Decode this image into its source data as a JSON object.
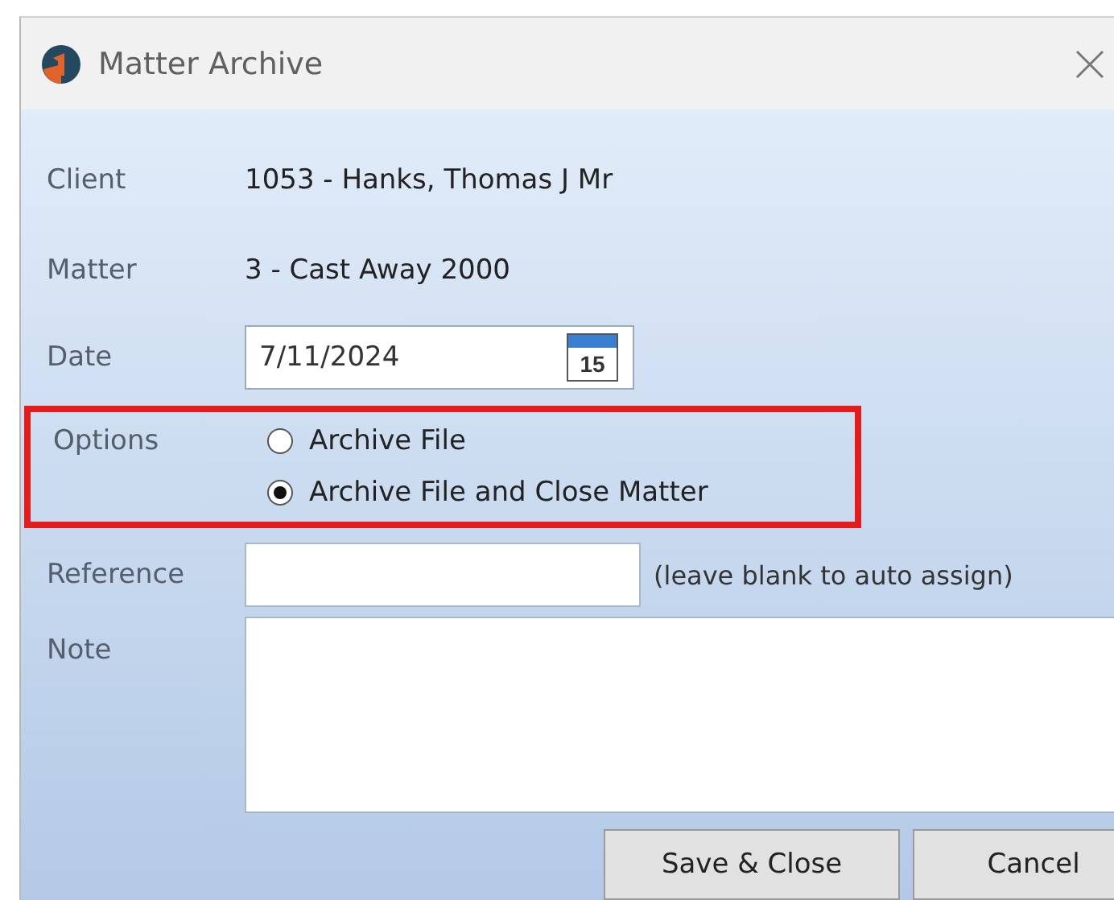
{
  "window": {
    "title": "Matter Archive"
  },
  "fields": [
    {
      "label": "Client",
      "value": "1053 - Hanks, Thomas J Mr"
    },
    {
      "label": "Matter",
      "value": "3 - Cast Away 2000"
    }
  ],
  "date": {
    "label": "Date",
    "value": "7/11/2024",
    "calendar_day": "15"
  },
  "options": {
    "label": "Options",
    "items": [
      {
        "label": "Archive File",
        "selected": false
      },
      {
        "label": "Archive File and Close Matter",
        "selected": true
      }
    ]
  },
  "reference": {
    "label": "Reference",
    "hint": "(leave blank to auto assign)"
  },
  "note": {
    "label": "Note"
  },
  "buttons": [
    "Save & Close",
    "Cancel"
  ]
}
